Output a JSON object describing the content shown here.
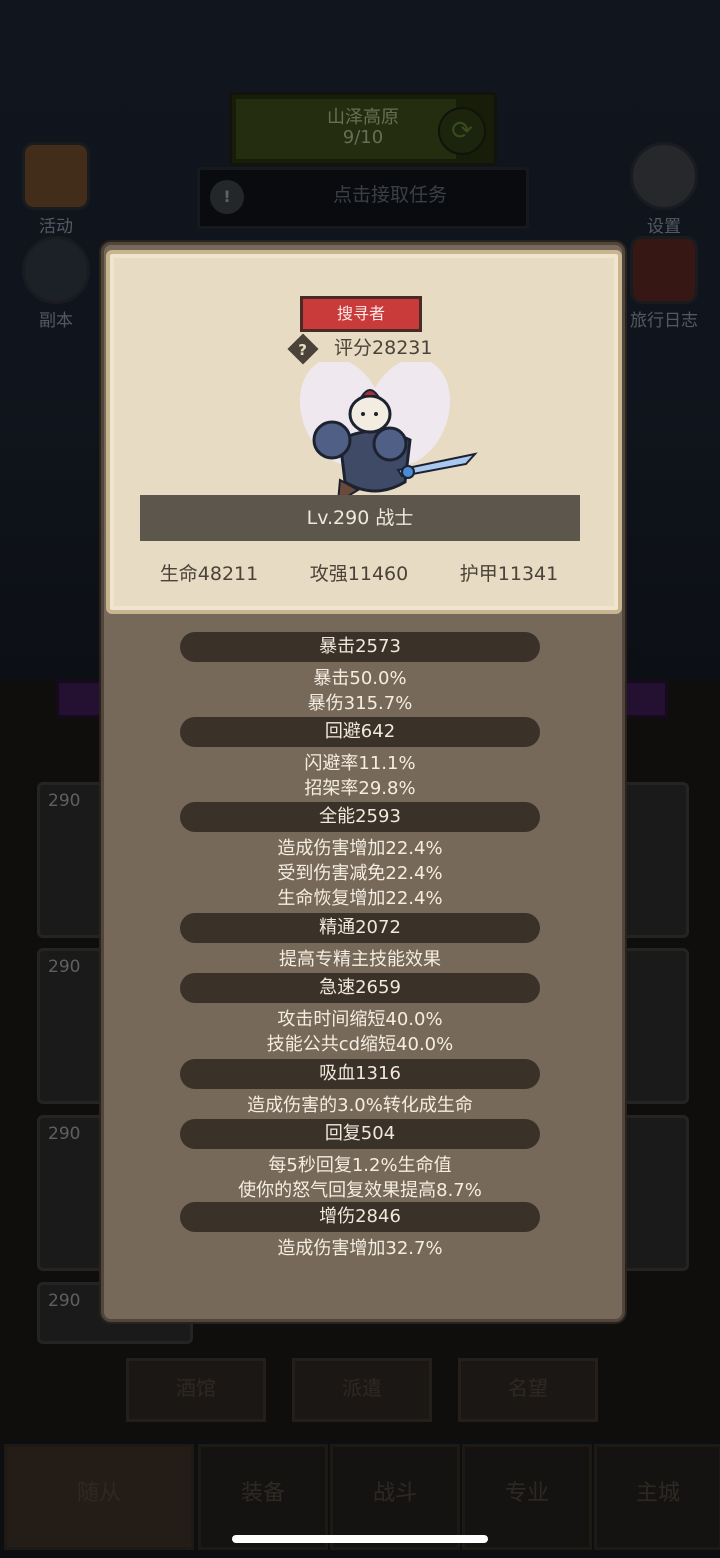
{
  "background": {
    "region": {
      "name": "山泽高原",
      "progress": "9/10"
    },
    "quest": {
      "label": "点击接取任务",
      "icon": "!"
    },
    "side": {
      "activity": "活动",
      "dungeon": "副本",
      "settings": "设置",
      "travel_log": "旅行日志"
    },
    "card_level": "290",
    "tabs": [
      "酒馆",
      "派遣",
      "名望"
    ],
    "nav": [
      "随从",
      "装备",
      "战斗",
      "专业",
      "主城"
    ]
  },
  "hero": {
    "role": "搜寻者",
    "score": "评分28231",
    "level_class": "Lv.290 战士",
    "stats": {
      "hp": "生命48211",
      "attack": "攻强11460",
      "armor": "护甲11341"
    }
  },
  "attributes": [
    {
      "name": "暴击2573",
      "lines": [
        "暴击50.0%",
        "暴伤315.7%"
      ]
    },
    {
      "name": "回避642",
      "lines": [
        "闪避率11.1%",
        "招架率29.8%"
      ]
    },
    {
      "name": "全能2593",
      "lines": [
        "造成伤害增加22.4%",
        "受到伤害减免22.4%",
        "生命恢复增加22.4%"
      ]
    },
    {
      "name": "精通2072",
      "lines": [
        "提高专精主技能效果"
      ]
    },
    {
      "name": "急速2659",
      "lines": [
        "攻击时间缩短40.0%",
        "技能公共cd缩短40.0%"
      ]
    },
    {
      "name": "吸血1316",
      "lines": [
        "造成伤害的3.0%转化成生命"
      ]
    },
    {
      "name": "回复504",
      "lines": [
        "每5秒回复1.2%生命值",
        "使你的怒气回复效果提高8.7%"
      ]
    },
    {
      "name": "增伤2846",
      "lines": [
        "造成伤害增加32.7%"
      ]
    }
  ],
  "colors": {
    "role_badge": "#c93a3a",
    "panel": "#77695a",
    "header": "#e7dcc3",
    "section_pill": "#3a3129"
  }
}
